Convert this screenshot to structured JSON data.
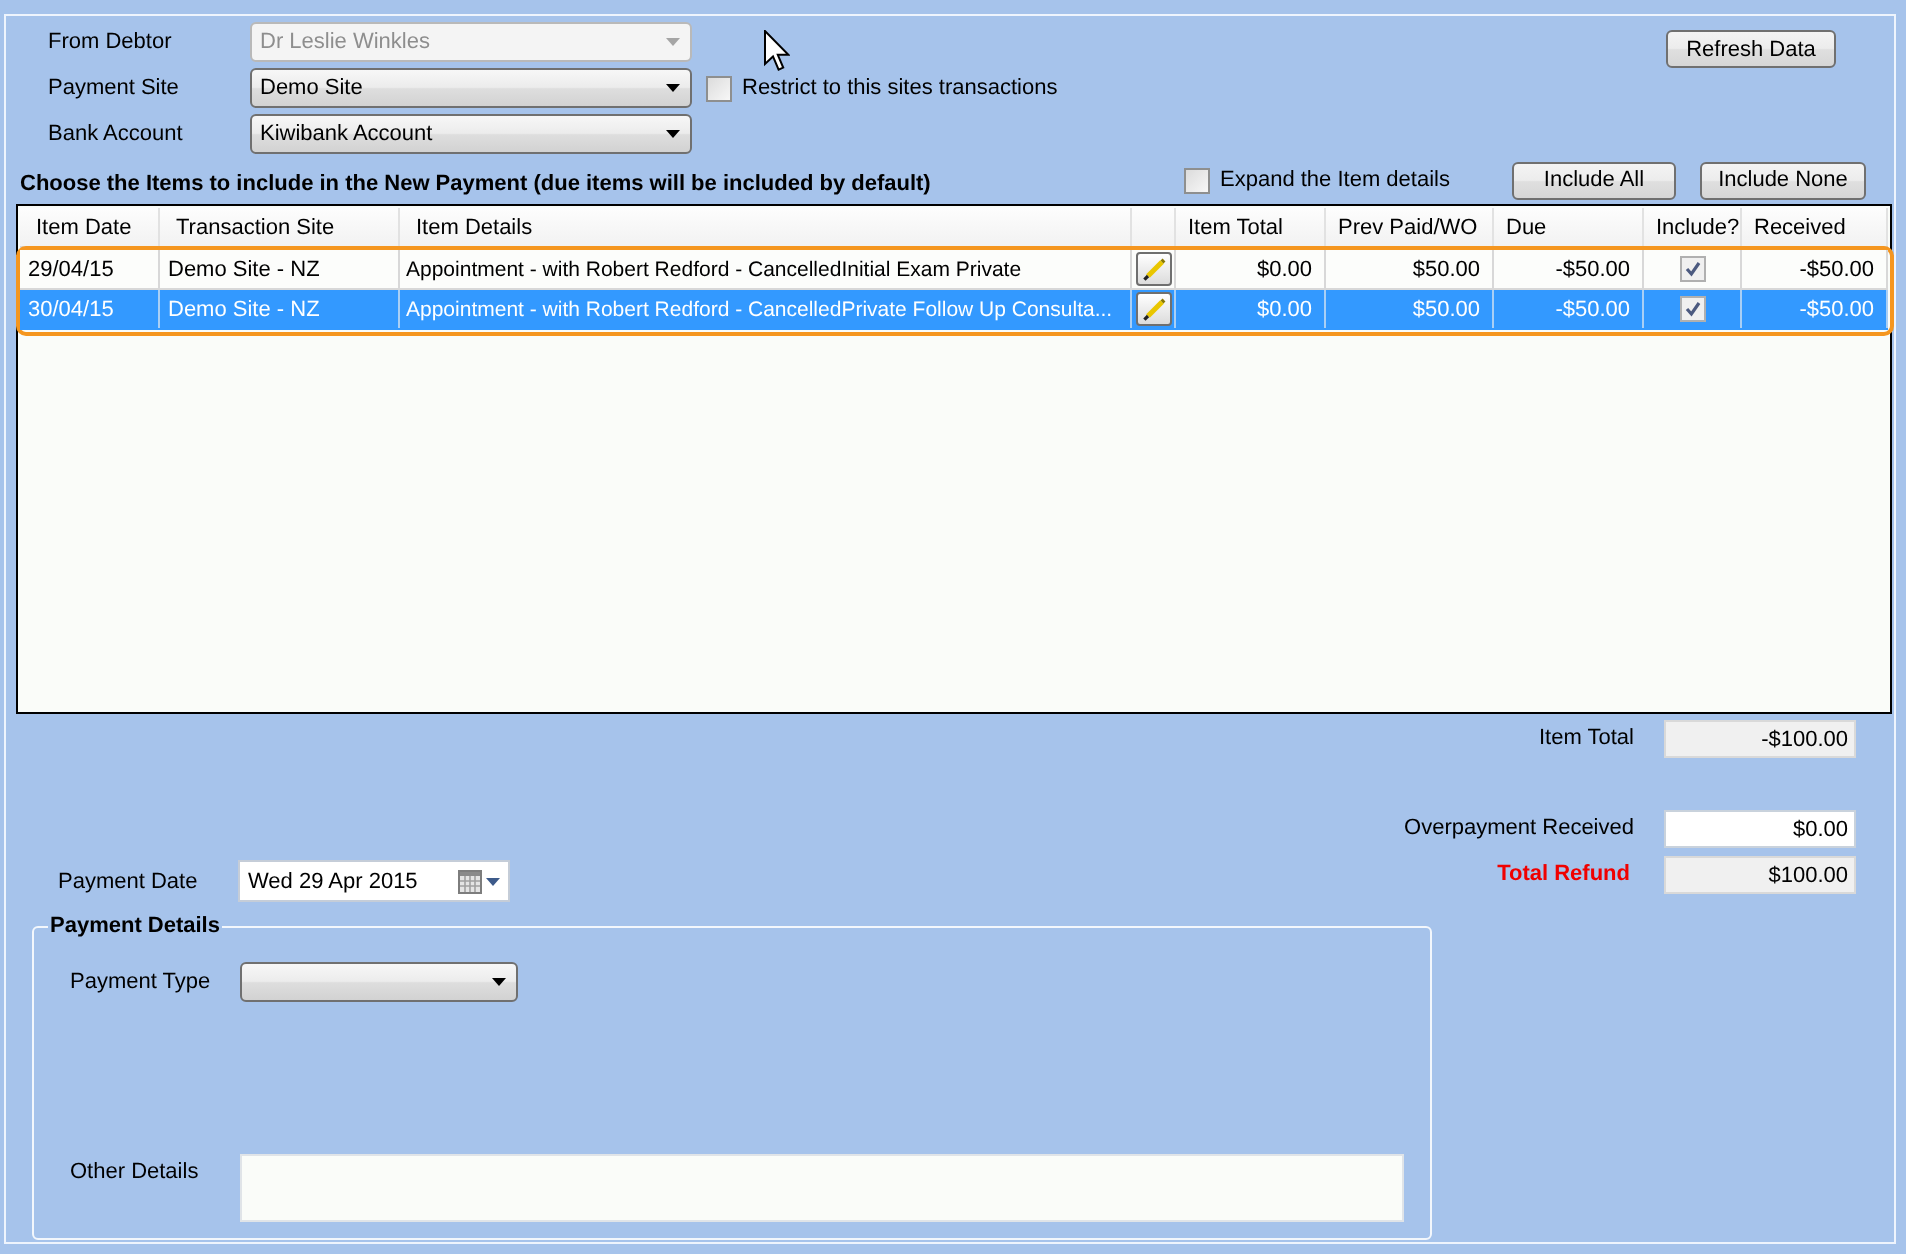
{
  "form": {
    "fields": [
      {
        "label": "From Debtor",
        "value": "Dr Leslie Winkles",
        "disabled": true
      },
      {
        "label": "Payment Site",
        "value": "Demo Site",
        "disabled": false,
        "option": {
          "label": "Restrict to this sites transactions",
          "checked": false
        }
      },
      {
        "label": "Bank Account",
        "value": "Kiwibank Account",
        "disabled": false
      }
    ],
    "refresh_button": "Refresh Data"
  },
  "items": {
    "heading": "Choose the Items to include in the New Payment (due items will be included by default)",
    "expand_option": {
      "label": "Expand the Item details",
      "checked": false
    },
    "buttons": [
      "Include All",
      "Include None"
    ]
  },
  "table": {
    "columns": [
      "Item Date",
      "Transaction Site",
      "Item Details",
      "Item Total",
      "Prev Paid/WO",
      "Due",
      "Include?",
      "Received"
    ],
    "outlined": true,
    "rows": [
      {
        "item_date": "29/04/15",
        "transaction_site": "Demo Site - NZ",
        "item_details": "Appointment - with Robert Redford - CancelledInitial Exam Private",
        "item_total": "$0.00",
        "prev_paid_wo": "$50.00",
        "due": "-$50.00",
        "include": true,
        "received": "-$50.00",
        "selected": false
      },
      {
        "item_date": "30/04/15",
        "transaction_site": "Demo Site - NZ",
        "item_details": "Appointment - with Robert Redford - CancelledPrivate Follow Up Consulta...",
        "item_total": "$0.00",
        "prev_paid_wo": "$50.00",
        "due": "-$50.00",
        "include": true,
        "received": "-$50.00",
        "selected": true
      }
    ]
  },
  "totals": [
    {
      "label": "Item Total",
      "value": "-$100.00",
      "readonly": true,
      "kind": "normal"
    },
    {
      "label": "Overpayment Received",
      "value": "$0.00",
      "readonly": false,
      "kind": "normal"
    },
    {
      "label": "Total Refund",
      "value": "$100.00",
      "readonly": true,
      "kind": "total"
    }
  ],
  "payment_date": {
    "label": "Payment Date",
    "value": "Wed 29 Apr 2015"
  },
  "payment_details": {
    "title": "Payment Details",
    "payment_type": {
      "label": "Payment Type"
    },
    "other_details": {
      "label": "Other Details"
    }
  }
}
